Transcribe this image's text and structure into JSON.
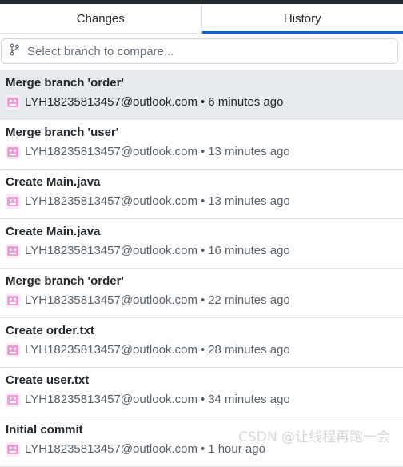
{
  "tabs": [
    {
      "label": "Changes",
      "selected": false
    },
    {
      "label": "History",
      "selected": true
    }
  ],
  "branch_compare": {
    "placeholder": "Select branch to compare...",
    "icon": "git-branch-icon"
  },
  "commits": [
    {
      "title": "Merge branch 'order'",
      "author": "LYH18235813457@outlook.com",
      "time": "6 minutes ago",
      "selected": true
    },
    {
      "title": "Merge branch 'user'",
      "author": "LYH18235813457@outlook.com",
      "time": "13 minutes ago",
      "selected": false
    },
    {
      "title": "Create Main.java",
      "author": "LYH18235813457@outlook.com",
      "time": "13 minutes ago",
      "selected": false
    },
    {
      "title": "Create Main.java",
      "author": "LYH18235813457@outlook.com",
      "time": "16 minutes ago",
      "selected": false
    },
    {
      "title": "Merge branch 'order'",
      "author": "LYH18235813457@outlook.com",
      "time": "22 minutes ago",
      "selected": false
    },
    {
      "title": "Create order.txt",
      "author": "LYH18235813457@outlook.com",
      "time": "28 minutes ago",
      "selected": false
    },
    {
      "title": "Create user.txt",
      "author": "LYH18235813457@outlook.com",
      "time": "34 minutes ago",
      "selected": false
    },
    {
      "title": "Initial commit",
      "author": "LYH18235813457@outlook.com",
      "time": "1 hour ago",
      "selected": false
    }
  ],
  "separator": "•",
  "watermark": "CSDN @让线程再跑一会",
  "colors": {
    "accent": "#0366d6",
    "avatar": "#e8a2d8",
    "selected_row": "#e6e9ed"
  }
}
